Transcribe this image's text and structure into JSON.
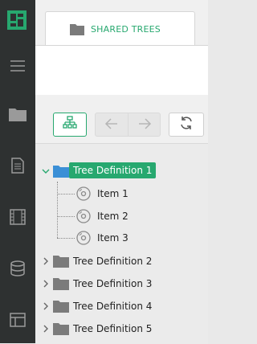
{
  "rail": {
    "accent": "#27a86f",
    "items": [
      {
        "icon": "menu-icon"
      },
      {
        "icon": "folder-icon"
      },
      {
        "icon": "document-icon"
      },
      {
        "icon": "film-icon"
      },
      {
        "icon": "database-icon"
      },
      {
        "icon": "table-icon"
      }
    ]
  },
  "tab": {
    "label": "SHARED TREES",
    "icon": "folder-icon"
  },
  "toolbar": {
    "buttons": [
      {
        "icon": "hierarchy-icon",
        "state": "active"
      },
      {
        "icon": "arrow-left-icon",
        "state": "disabled"
      },
      {
        "icon": "arrow-right-icon",
        "state": "disabled"
      },
      {
        "icon": "refresh-icon",
        "state": "enabled"
      }
    ]
  },
  "tree": {
    "nodes": [
      {
        "label": "Tree Definition 1",
        "expanded": true,
        "selected": true,
        "children": [
          {
            "label": "Item 1"
          },
          {
            "label": "Item 2"
          },
          {
            "label": "Item 3"
          }
        ]
      },
      {
        "label": "Tree Definition 2",
        "expanded": false
      },
      {
        "label": "Tree Definition 3",
        "expanded": false
      },
      {
        "label": "Tree Definition 4",
        "expanded": false
      },
      {
        "label": "Tree Definition 5",
        "expanded": false
      }
    ]
  },
  "colors": {
    "accent": "#27a86f",
    "rail_bg": "#2e3131",
    "selected_folder": "#3b8fd6",
    "folder": "#7b7b7b"
  }
}
